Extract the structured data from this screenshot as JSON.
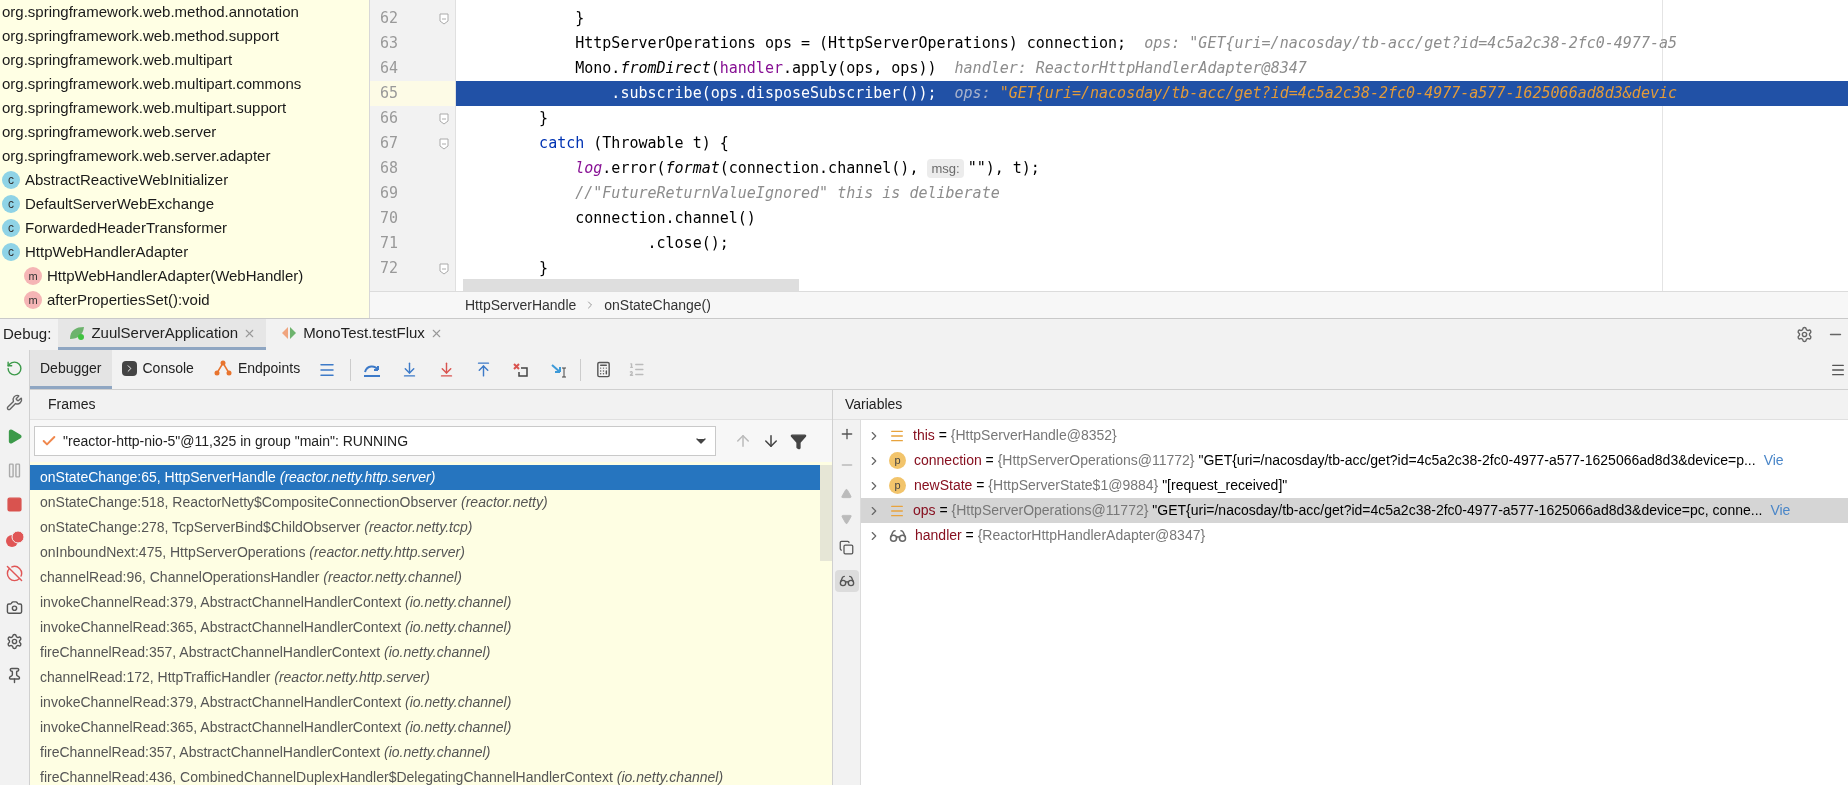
{
  "project_tree": [
    {
      "kind": "package",
      "label": "org.springframework.web.method.annotation"
    },
    {
      "kind": "package",
      "label": "org.springframework.web.method.support"
    },
    {
      "kind": "package",
      "label": "org.springframework.web.multipart"
    },
    {
      "kind": "package",
      "label": "org.springframework.web.multipart.commons"
    },
    {
      "kind": "package",
      "label": "org.springframework.web.multipart.support"
    },
    {
      "kind": "package",
      "label": "org.springframework.web.server"
    },
    {
      "kind": "package",
      "label": "org.springframework.web.server.adapter"
    },
    {
      "kind": "class",
      "icon_letter": "c",
      "label": "AbstractReactiveWebInitializer"
    },
    {
      "kind": "class",
      "icon_letter": "c",
      "label": "DefaultServerWebExchange"
    },
    {
      "kind": "class",
      "icon_letter": "c",
      "label": "ForwardedHeaderTransformer"
    },
    {
      "kind": "class",
      "icon_letter": "c",
      "label": "HttpWebHandlerAdapter"
    },
    {
      "kind": "method",
      "icon_letter": "m",
      "label": "HttpWebHandlerAdapter(WebHandler)"
    },
    {
      "kind": "method",
      "icon_letter": "m",
      "label": "afterPropertiesSet():void"
    }
  ],
  "editor": {
    "lines": [
      {
        "number": "62",
        "current": false,
        "fold": true,
        "segments": [
          {
            "kind": "plain",
            "text": "        }"
          }
        ]
      },
      {
        "number": "63",
        "current": false,
        "fold": false,
        "segments": [
          {
            "kind": "plain",
            "text": "        HttpServerOperations ops = (HttpServerOperations) connection;  "
          },
          {
            "kind": "hint",
            "text": "ops: "
          },
          {
            "kind": "hint-value",
            "text": "\"GET{uri=/nacosday/tb-acc/get?id=4c5a2c38-2fc0-4977-a5"
          }
        ]
      },
      {
        "number": "64",
        "current": false,
        "fold": false,
        "segments": [
          {
            "kind": "plain",
            "text": "        Mono."
          },
          {
            "kind": "italic",
            "text": "fromDirect"
          },
          {
            "kind": "plain",
            "text": "("
          },
          {
            "kind": "field",
            "text": "handler"
          },
          {
            "kind": "plain",
            "text": ".apply(ops, ops))  "
          },
          {
            "kind": "hint",
            "text": "handler: ReactorHttpHandlerAdapter@8347"
          }
        ]
      },
      {
        "number": "65",
        "current": true,
        "fold": false,
        "segments": [
          {
            "kind": "plain",
            "text": "            .subscribe(ops.disposeSubscriber());  "
          },
          {
            "kind": "hint",
            "text": "ops: "
          },
          {
            "kind": "hint-value",
            "text": "\"GET{uri=/nacosday/tb-acc/get?id=4c5a2c38-2fc0-4977-a577-1625066ad8d3&devic"
          }
        ]
      },
      {
        "number": "66",
        "current": false,
        "fold": true,
        "segments": [
          {
            "kind": "plain",
            "text": "    }"
          }
        ]
      },
      {
        "number": "67",
        "current": false,
        "fold": true,
        "segments": [
          {
            "kind": "keyword",
            "text": "    catch"
          },
          {
            "kind": "plain",
            "text": " (Throwable t) {"
          }
        ]
      },
      {
        "number": "68",
        "current": false,
        "fold": false,
        "segments": [
          {
            "kind": "static",
            "text": "        log"
          },
          {
            "kind": "plain",
            "text": ".error("
          },
          {
            "kind": "italic",
            "text": "format"
          },
          {
            "kind": "plain",
            "text": "(connection.channel(), "
          },
          {
            "kind": "inlay",
            "text": "msg:"
          },
          {
            "kind": "plain",
            "text": "\"\"), t);"
          }
        ]
      },
      {
        "number": "69",
        "current": false,
        "fold": false,
        "segments": [
          {
            "kind": "comment",
            "text": "        //\"FutureReturnValueIgnored\" this is deliberate"
          }
        ]
      },
      {
        "number": "70",
        "current": false,
        "fold": false,
        "segments": [
          {
            "kind": "plain",
            "text": "        connection.channel()"
          }
        ]
      },
      {
        "number": "71",
        "current": false,
        "fold": false,
        "segments": [
          {
            "kind": "plain",
            "text": "                .close();"
          }
        ]
      },
      {
        "number": "72",
        "current": false,
        "fold": true,
        "segments": [
          {
            "kind": "plain",
            "text": "    }"
          }
        ]
      }
    ],
    "breadcrumbs": [
      "HttpServerHandle",
      "onStateChange()"
    ]
  },
  "debug": {
    "label": "Debug:",
    "sessions": [
      {
        "kind": "spring",
        "label": "ZuulServerApplication",
        "selected": true
      },
      {
        "kind": "test",
        "label": "MonoTest.testFlux",
        "selected": false
      }
    ],
    "tabs": [
      {
        "kind": "debugger",
        "label": "Debugger",
        "selected": true
      },
      {
        "kind": "console",
        "label": "Console",
        "selected": false
      },
      {
        "kind": "endpoints",
        "label": "Endpoints",
        "selected": false
      }
    ],
    "frames": {
      "title": "Frames",
      "thread": "\"reactor-http-nio-5\"@11,325 in group \"main\": RUNNING",
      "items": [
        {
          "method": "onStateChange:65, HttpServerHandle",
          "package": "(reactor.netty.http.server)",
          "selected": true
        },
        {
          "method": "onStateChange:518, ReactorNetty$CompositeConnectionObserver",
          "package": "(reactor.netty)",
          "selected": false
        },
        {
          "method": "onStateChange:278, TcpServerBind$ChildObserver",
          "package": "(reactor.netty.tcp)",
          "selected": false
        },
        {
          "method": "onInboundNext:475, HttpServerOperations",
          "package": "(reactor.netty.http.server)",
          "selected": false
        },
        {
          "method": "channelRead:96, ChannelOperationsHandler",
          "package": "(reactor.netty.channel)",
          "selected": false
        },
        {
          "method": "invokeChannelRead:379, AbstractChannelHandlerContext",
          "package": "(io.netty.channel)",
          "selected": false
        },
        {
          "method": "invokeChannelRead:365, AbstractChannelHandlerContext",
          "package": "(io.netty.channel)",
          "selected": false
        },
        {
          "method": "fireChannelRead:357, AbstractChannelHandlerContext",
          "package": "(io.netty.channel)",
          "selected": false
        },
        {
          "method": "channelRead:172, HttpTrafficHandler",
          "package": "(reactor.netty.http.server)",
          "selected": false
        },
        {
          "method": "invokeChannelRead:379, AbstractChannelHandlerContext",
          "package": "(io.netty.channel)",
          "selected": false
        },
        {
          "method": "invokeChannelRead:365, AbstractChannelHandlerContext",
          "package": "(io.netty.channel)",
          "selected": false
        },
        {
          "method": "fireChannelRead:357, AbstractChannelHandlerContext",
          "package": "(io.netty.channel)",
          "selected": false
        },
        {
          "method": "fireChannelRead:436, CombinedChannelDuplexHandler$DelegatingChannelHandlerContext",
          "package": "(io.netty.channel)",
          "selected": false
        }
      ]
    },
    "variables": {
      "title": "Variables",
      "items": [
        {
          "kind": "field",
          "name": "this",
          "assign": "=",
          "type": "{HttpServerHandle@8352}",
          "selected": false
        },
        {
          "kind": "param",
          "icon_letter": "p",
          "name": "connection",
          "assign": "=",
          "type": "{HttpServerOperations@11772}",
          "value": "\"GET{uri=/nacosday/tb-acc/get?id=4c5a2c38-2fc0-4977-a577-1625066ad8d3&device=p...",
          "link": "Vie",
          "selected": false
        },
        {
          "kind": "param",
          "icon_letter": "p",
          "name": "newState",
          "assign": "=",
          "type": "{HttpServerState$1@9884}",
          "value": "\"[request_received]\"",
          "selected": false
        },
        {
          "kind": "field",
          "name": "ops",
          "assign": "=",
          "type": "{HttpServerOperations@11772}",
          "value": "\"GET{uri=/nacosday/tb-acc/get?id=4c5a2c38-2fc0-4977-a577-1625066ad8d3&device=pc, conne...",
          "link": "Vie",
          "selected": true
        },
        {
          "kind": "watch",
          "name": "handler",
          "assign": "=",
          "type": "{ReactorHttpHandlerAdapter@8347}",
          "selected": false
        }
      ]
    }
  }
}
